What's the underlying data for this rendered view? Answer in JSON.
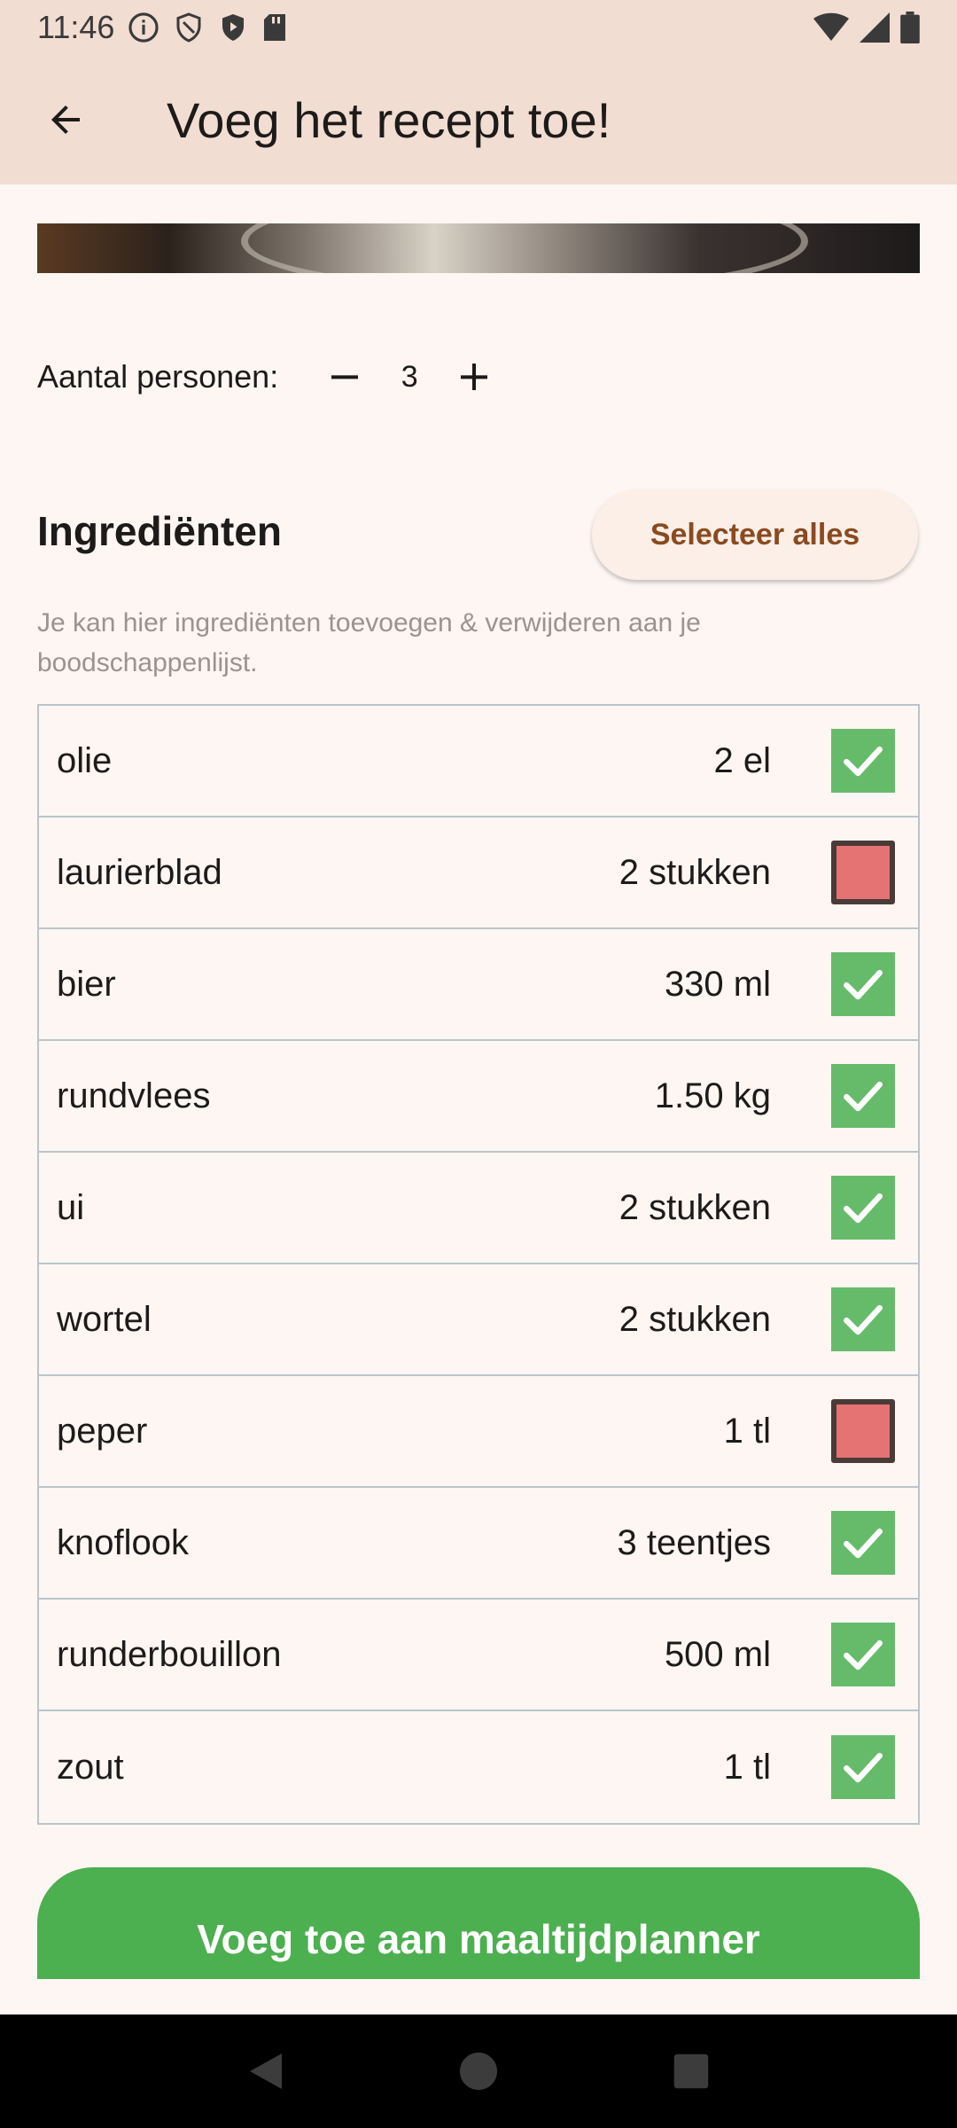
{
  "status_bar": {
    "time": "11:46"
  },
  "app_bar": {
    "title": "Voeg het recept toe!"
  },
  "servings": {
    "label": "Aantal personen:",
    "count": "3"
  },
  "ingredients_section": {
    "title": "Ingrediënten",
    "select_all_label": "Selecteer alles",
    "hint": "Je kan hier ingrediënten toevoegen & verwijderen aan je boodschappenlijst.",
    "items": [
      {
        "name": "olie",
        "quantity": "2 el",
        "checked": true
      },
      {
        "name": "laurierblad",
        "quantity": "2 stukken",
        "checked": false
      },
      {
        "name": "bier",
        "quantity": "330 ml",
        "checked": true
      },
      {
        "name": "rundvlees",
        "quantity": "1.50 kg",
        "checked": true
      },
      {
        "name": "ui",
        "quantity": "2 stukken",
        "checked": true
      },
      {
        "name": "wortel",
        "quantity": "2 stukken",
        "checked": true
      },
      {
        "name": "peper",
        "quantity": "1 tl",
        "checked": false
      },
      {
        "name": "knoflook",
        "quantity": "3 teentjes",
        "checked": true
      },
      {
        "name": "runderbouillon",
        "quantity": "500 ml",
        "checked": true
      },
      {
        "name": "zout",
        "quantity": "1 tl",
        "checked": true
      }
    ]
  },
  "cta": {
    "label": "Voeg toe aan maaltijdplanner"
  },
  "colors": {
    "checked": "#66bb6a",
    "unchecked": "#e57373",
    "cta": "#4caf50",
    "app_bar": "#f2ddd3"
  }
}
